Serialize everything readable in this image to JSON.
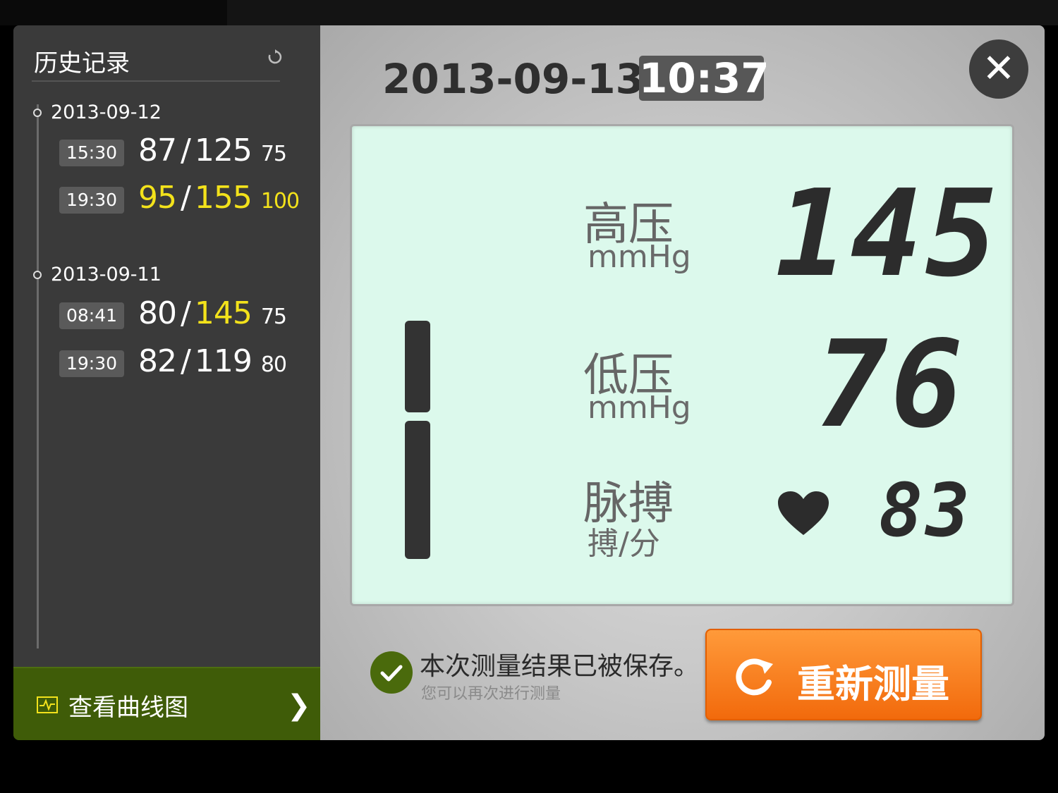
{
  "sidebar": {
    "title": "历史记录",
    "groups": [
      {
        "date": "2013-09-12",
        "entries": [
          {
            "time": "15:30",
            "low": "87",
            "high": "125",
            "pulse": "75",
            "highlight": false
          },
          {
            "time": "19:30",
            "low": "95",
            "high": "155",
            "pulse": "100",
            "highlight": true
          }
        ]
      },
      {
        "date": "2013-09-11",
        "entries": [
          {
            "time": "08:41",
            "low": "80",
            "high": "145",
            "pulse": "75",
            "highlight": "high-only"
          },
          {
            "time": "19:30",
            "low": "82",
            "high": "119",
            "pulse": "80",
            "highlight": false
          }
        ]
      }
    ],
    "chart_link": "查看曲线图",
    "separator": "/"
  },
  "main": {
    "date": "2013-09-13",
    "time": "10:37",
    "close_symbol": "✕",
    "systolic": {
      "label": "高压",
      "unit": "mmHg",
      "value": "145"
    },
    "diastolic": {
      "label": "低压",
      "unit": "mmHg",
      "value": "76"
    },
    "pulse": {
      "label": "脉搏",
      "unit": "搏/分",
      "value": "83"
    },
    "saved_message": "本次测量结果已被保存。",
    "saved_sub": "您可以再次进行测量",
    "remeasure_label": "重新测量"
  },
  "colors": {
    "highlight_yellow": "#f3e21b",
    "lcd_background": "#dcf9ec",
    "chart_bar_green": "#3f5c08",
    "button_orange": "#f2780f"
  },
  "icons": [
    "refresh-icon",
    "chart-icon",
    "chevron-right-icon",
    "close-icon",
    "heart-icon",
    "check-icon",
    "refresh-arrow-icon"
  ]
}
